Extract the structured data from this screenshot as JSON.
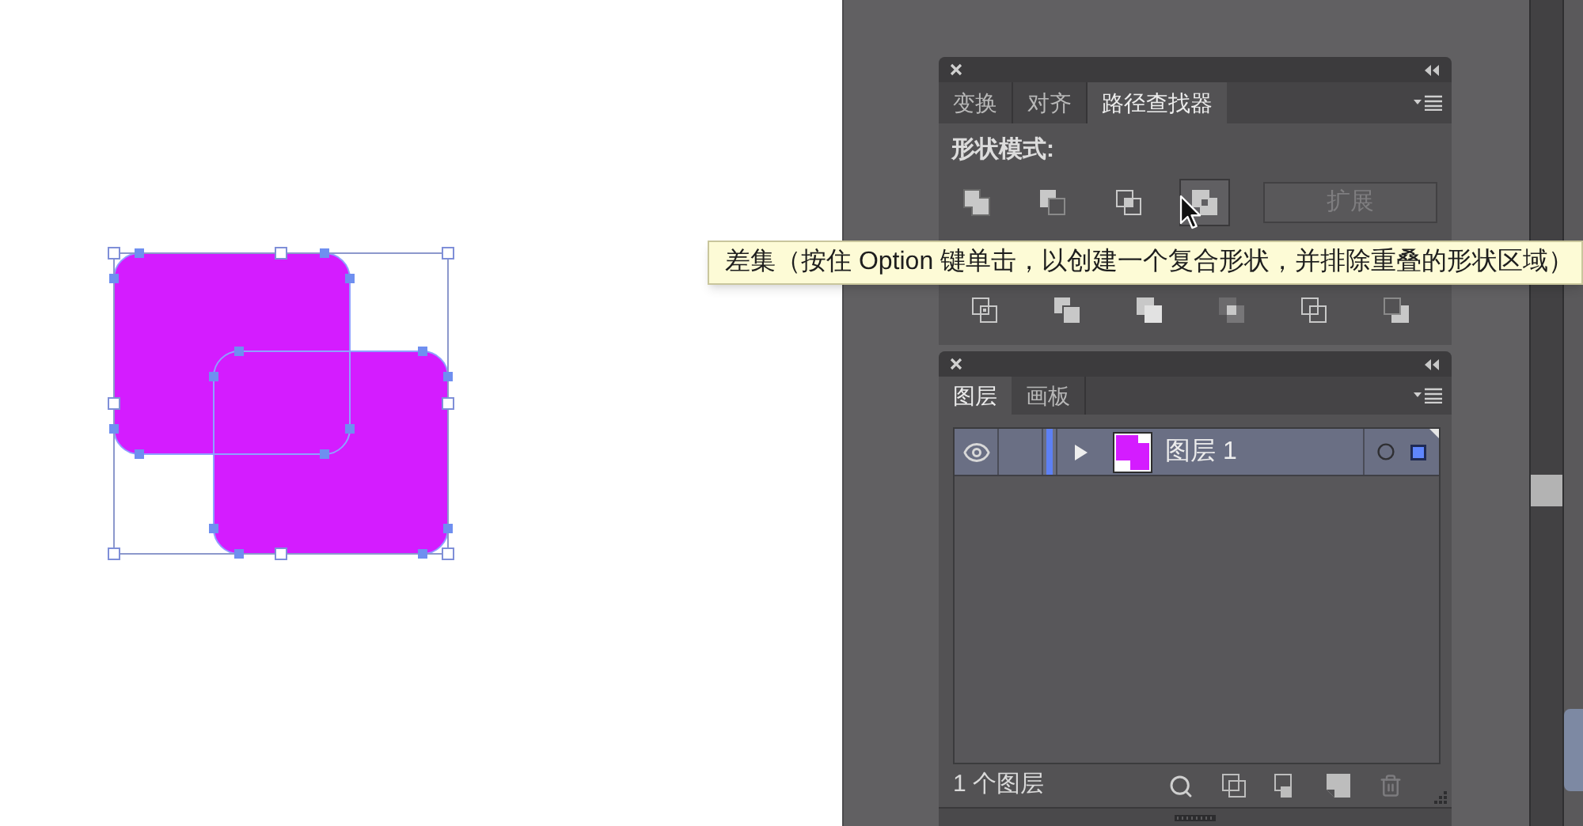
{
  "pathfinder_panel": {
    "tabs": [
      {
        "label": "变换",
        "selected": false
      },
      {
        "label": "对齐",
        "selected": false
      },
      {
        "label": "路径查找器",
        "selected": true
      }
    ],
    "shape_modes": {
      "label": "形状模式:",
      "buttons": [
        {
          "kind": "unite",
          "hovered": false
        },
        {
          "kind": "minus",
          "hovered": false
        },
        {
          "kind": "intersect",
          "hovered": false
        },
        {
          "kind": "exclude",
          "hovered": true
        }
      ],
      "expand_button": {
        "label": "扩展",
        "disabled": true
      }
    },
    "pathfinders": {
      "buttons": [
        {
          "kind": "divide"
        },
        {
          "kind": "trim"
        },
        {
          "kind": "merge"
        },
        {
          "kind": "crop"
        },
        {
          "kind": "outline"
        },
        {
          "kind": "backminus"
        }
      ]
    }
  },
  "tooltip": {
    "text": "差集（按住 Option 键单击，以创建一个复合形状，并排除重叠的形状区域）"
  },
  "layers_panel": {
    "tabs": [
      {
        "label": "图层",
        "selected": true
      },
      {
        "label": "画板",
        "selected": false
      }
    ],
    "layers": [
      {
        "name": "图层 1",
        "selected": true,
        "visible": true,
        "expanded": false,
        "art_selected": true
      }
    ],
    "status": "1 个图层"
  }
}
